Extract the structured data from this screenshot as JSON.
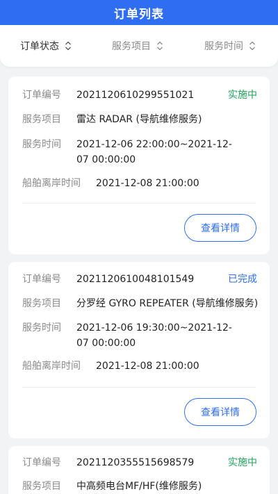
{
  "header": {
    "title": "订单列表"
  },
  "filters": [
    {
      "label": "订单状态",
      "icon": "sort-icon"
    },
    {
      "label": "服务项目",
      "icon": "sort-icon"
    },
    {
      "label": "服务时间",
      "icon": "sort-icon"
    }
  ],
  "labels": {
    "order_no": "订单编号",
    "service_item": "服务项目",
    "service_time": "服务时间",
    "departure_time": "船舶离岸时间"
  },
  "colors": {
    "primary": "#2f6ef2",
    "in_progress": "#21a35c",
    "completed": "#2f6ef2"
  },
  "orders": [
    {
      "order_no": "2021120610299551021",
      "status": "实施中",
      "service_item": "雷达 RADAR (导航维修服务)",
      "service_time": "2021-12-06 22:00:00~2021-12-07 00:00:00",
      "departure_time": "2021-12-08 21:00:00",
      "detail_button": "查看详情"
    },
    {
      "order_no": "2021120610048101549",
      "status": "已完成",
      "service_item": "分罗经 GYRO REPEATER (导航维修服务)",
      "service_time": "2021-12-06 19:30:00~2021-12-07 00:00:00",
      "departure_time": "2021-12-08 21:00:00",
      "detail_button": "查看详情"
    },
    {
      "order_no": "2021120355515698579",
      "status": "实施中",
      "service_item": "中高频电台MF/HF(维修服务)"
    }
  ]
}
